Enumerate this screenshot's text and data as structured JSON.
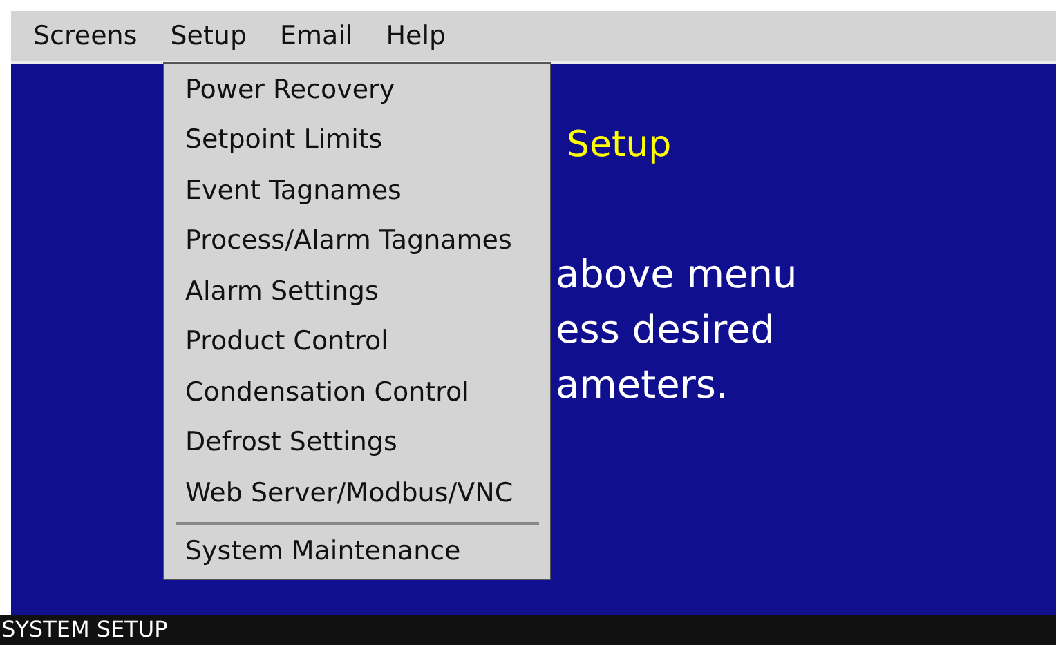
{
  "menu_bar": [
    {
      "label": "Screens"
    },
    {
      "label": "Setup"
    },
    {
      "label": "Email"
    },
    {
      "label": "Help"
    }
  ],
  "dropdown": [
    {
      "kind": "item",
      "label": "Power Recovery"
    },
    {
      "kind": "item",
      "label": "Setpoint Limits"
    },
    {
      "kind": "item",
      "label": "Event Tagnames"
    },
    {
      "kind": "item",
      "label": "Process/Alarm Tagnames"
    },
    {
      "kind": "item",
      "label": "Alarm Settings"
    },
    {
      "kind": "item",
      "label": "Product Control"
    },
    {
      "kind": "item",
      "label": "Condensation Control"
    },
    {
      "kind": "item",
      "label": "Defrost Settings"
    },
    {
      "kind": "item",
      "label": "Web Server/Modbus/VNC"
    },
    {
      "kind": "separator"
    },
    {
      "kind": "item",
      "label": "System Maintenance"
    }
  ],
  "main": {
    "title": "Setup",
    "lines": [
      "above menu",
      "ess desired",
      "ameters."
    ]
  },
  "status_bar": "SYSTEM SETUP"
}
